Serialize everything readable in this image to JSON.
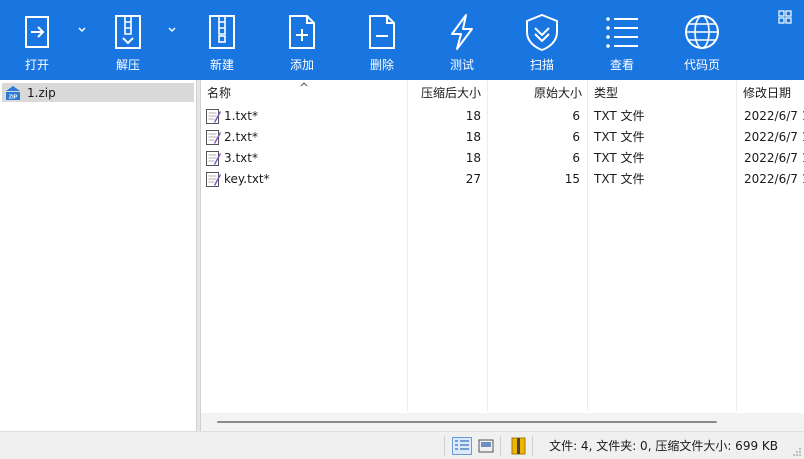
{
  "toolbar": {
    "buttons": [
      {
        "id": "open",
        "label": "打开",
        "icon": "open-icon"
      },
      {
        "id": "extract",
        "label": "解压",
        "icon": "extract-icon"
      },
      {
        "id": "new",
        "label": "新建",
        "icon": "new-archive-icon"
      },
      {
        "id": "add",
        "label": "添加",
        "icon": "add-file-icon"
      },
      {
        "id": "delete",
        "label": "删除",
        "icon": "delete-file-icon"
      },
      {
        "id": "test",
        "label": "测试",
        "icon": "lightning-icon"
      },
      {
        "id": "scan",
        "label": "扫描",
        "icon": "shield-icon"
      },
      {
        "id": "view",
        "label": "查看",
        "icon": "list-view-icon"
      },
      {
        "id": "codepage",
        "label": "代码页",
        "icon": "globe-icon"
      }
    ],
    "accent": "#1976e0"
  },
  "tree": {
    "items": [
      {
        "label": "1.zip",
        "icon": "zip-archive-icon"
      }
    ]
  },
  "list": {
    "columns": [
      "名称",
      "压缩后大小",
      "原始大小",
      "类型",
      "修改日期"
    ],
    "rows": [
      {
        "name": "1.txt*",
        "compressed": "18",
        "original": "6",
        "type": "TXT 文件",
        "modified": "2022/6/7 1"
      },
      {
        "name": "2.txt*",
        "compressed": "18",
        "original": "6",
        "type": "TXT 文件",
        "modified": "2022/6/7 1"
      },
      {
        "name": "3.txt*",
        "compressed": "18",
        "original": "6",
        "type": "TXT 文件",
        "modified": "2022/6/7 1"
      },
      {
        "name": "key.txt*",
        "compressed": "27",
        "original": "15",
        "type": "TXT 文件",
        "modified": "2022/6/7 1"
      }
    ]
  },
  "status": {
    "summary": "文件: 4, 文件夹: 0, 压缩文件大小: 699 KB"
  }
}
